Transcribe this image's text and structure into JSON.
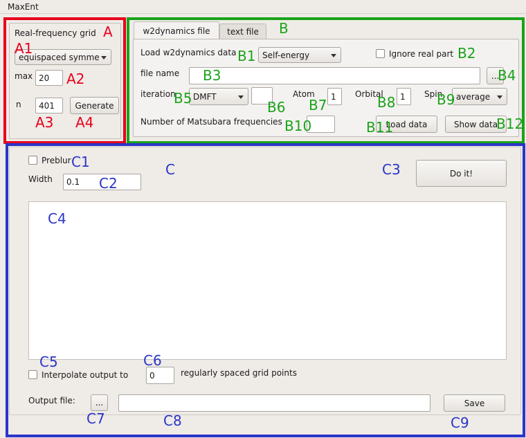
{
  "window": {
    "title": "MaxEnt"
  },
  "annotations": {
    "A": "A",
    "A1": "A1",
    "A2": "A2",
    "A3": "A3",
    "A4": "A4",
    "B": "B",
    "B1": "B1",
    "B2": "B2",
    "B3": "B3",
    "B4": "B4",
    "B5": "B5",
    "B6": "B6",
    "B7": "B7",
    "B8": "B8",
    "B9": "B9",
    "B10": "B10",
    "B11": "B11",
    "B12": "B12",
    "C": "C",
    "C1": "C1",
    "C2": "C2",
    "C3": "C3",
    "C4": "C4",
    "C5": "C5",
    "C6": "C6",
    "C7": "C7",
    "C8": "C8",
    "C9": "C9"
  },
  "grid_panel": {
    "title": "Real-frequency grid",
    "grid_type": "equispaced symme",
    "max_label": "max",
    "max_value": "20",
    "n_label": "n",
    "n_value": "401",
    "generate_label": "Generate"
  },
  "load_panel": {
    "tabs": [
      "w2dynamics file",
      "text file"
    ],
    "active_tab": "w2dynamics file",
    "load_label": "Load w2dynamics data",
    "data_type": "Self-energy",
    "ignore_real_label": "Ignore real part",
    "file_name_label": "file name",
    "file_name_value": "",
    "browse_label": "...",
    "iteration_label": "iteration",
    "iteration_type": "DMFT",
    "iteration_value": "",
    "atom_label": "Atom",
    "atom_value": "1",
    "orbital_label": "Orbital",
    "orbital_value": "1",
    "spin_label": "Spin",
    "spin_value": "average",
    "matsubara_label": "Number of Matsubara frequencies",
    "matsubara_value": "",
    "load_data_label": "Load data",
    "show_data_label": "Show data"
  },
  "main_panel": {
    "preblur_label": "Preblur",
    "width_label": "Width",
    "width_value": "0.1",
    "doit_label": "Do it!",
    "interpolate_label": "Interpolate output to",
    "interpolate_value": "0",
    "grid_points_label": "regularly spaced grid points",
    "output_file_label": "Output file:",
    "output_browse_label": "...",
    "output_file_value": "",
    "save_label": "Save"
  },
  "colors": {
    "annotation_red": "#e8001c",
    "annotation_green": "#1aa31a",
    "annotation_blue": "#2a35c8"
  }
}
